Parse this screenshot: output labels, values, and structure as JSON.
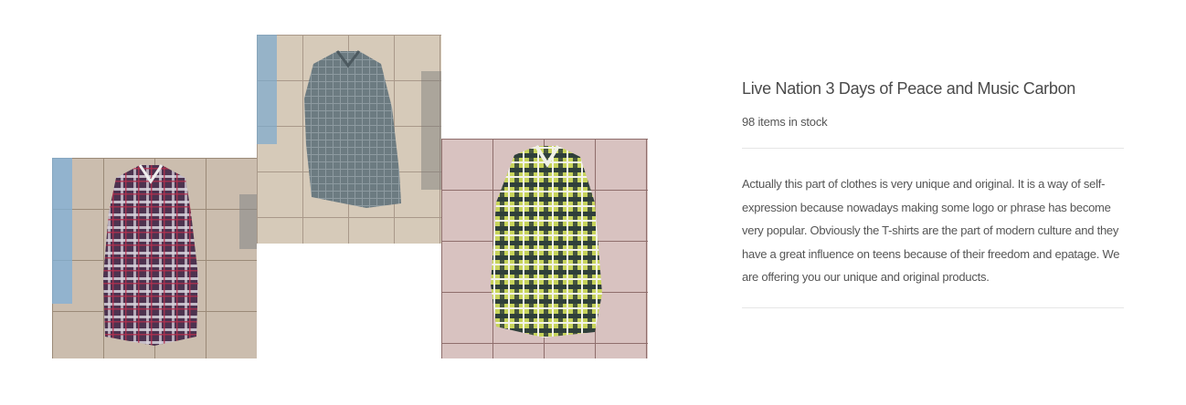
{
  "product": {
    "title": "Live Nation 3 Days of Peace and Music Carbon",
    "stock": "98 items in stock",
    "description": "Actually this part of clothes is very unique and original. It is a way of self-expression because nowadays making some logo or phrase has become very popular. Obviously the T-shirts are the part of modern culture and they have a great influence on teens because of their freedom and epatage. We are offering you our unique and original products."
  },
  "gallery": [
    {
      "icon": "plaid-shirt-purple-icon",
      "shirt_color": "#5a3f5c",
      "floor_color": "#cdbfb0"
    },
    {
      "icon": "plaid-shirt-gray-icon",
      "shirt_color": "#6b7a80",
      "floor_color": "#d9cdbd"
    },
    {
      "icon": "plaid-shirt-green-icon",
      "shirt_color": "#b9c94a",
      "floor_color": "#d8c3c1"
    }
  ]
}
